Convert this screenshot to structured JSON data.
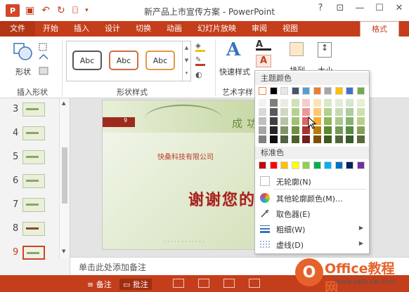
{
  "window": {
    "title": "新产品上市宣传方案 - PowerPoint",
    "app_icon_letter": "P",
    "controls": [
      "?",
      "⊡",
      "—",
      "☐",
      "✕"
    ]
  },
  "tabs": [
    "文件",
    "开始",
    "插入",
    "设计",
    "切换",
    "动画",
    "幻灯片放映",
    "审阅",
    "视图",
    "格式"
  ],
  "ribbon": {
    "shape_label": "形状",
    "insert_shapes_group": "插入形状",
    "shape_styles_group": "形状样式",
    "art_text_group": "艺术字样",
    "quick_styles_label": "快速样式",
    "arrange_label": "排列",
    "size_label": "大小",
    "abc_samples": [
      "Abc",
      "Abc",
      "Abc"
    ],
    "abc_border_colors": [
      "#555555",
      "#d16b44",
      "#e29a45"
    ]
  },
  "slides": {
    "numbers": [
      "3",
      "4",
      "5",
      "6",
      "7",
      "8",
      "9"
    ],
    "selected": "9"
  },
  "slide_content": {
    "company": "快桑科技有限公司",
    "big_text": "谢谢您的",
    "header_text": "成功",
    "tag_number": "9"
  },
  "notes": {
    "placeholder": "单击此处添加备注"
  },
  "statusbar": {
    "notes_label": "备注",
    "comments_label": "批注"
  },
  "dropdown": {
    "theme_colors_label": "主题颜色",
    "standard_colors_label": "标准色",
    "theme_top_row": [
      "#ffffff",
      "#000000",
      "#e7e6e6",
      "#44546a",
      "#5b9bd5",
      "#ed7d31",
      "#a5a5a5",
      "#ffc000",
      "#4472c4",
      "#70ad47"
    ],
    "theme_columns": [
      [
        "#f2f2f2",
        "#d9d9d9",
        "#bfbfbf",
        "#a6a6a6",
        "#808080"
      ],
      [
        "#7f7f7f",
        "#595959",
        "#404040",
        "#262626",
        "#0d0d0d"
      ],
      [
        "#e8ece3",
        "#cfd8c2",
        "#b5c4a1",
        "#7f956a",
        "#52643f"
      ],
      [
        "#cfe1b5",
        "#b7d193",
        "#9fc270",
        "#6f9141",
        "#4a612b"
      ],
      [
        "#f4cccc",
        "#e99999",
        "#de6666",
        "#a83333",
        "#701f1f"
      ],
      [
        "#fde3b8",
        "#fbc772",
        "#f9ab2c",
        "#b97a0b",
        "#7b5107"
      ],
      [
        "#d9e7c6",
        "#b3cf8e",
        "#8db756",
        "#5b8a2c",
        "#3c5c1d"
      ],
      [
        "#e3ecd8",
        "#c7d9b2",
        "#abc78b",
        "#77995a",
        "#4f663c"
      ],
      [
        "#d6e6cf",
        "#aecd9f",
        "#86b46f",
        "#558a3f",
        "#385c2a"
      ],
      [
        "#e7efd7",
        "#cfdfb0",
        "#b7cf88",
        "#86a057",
        "#596b3a"
      ]
    ],
    "standard_colors": [
      "#c00000",
      "#ff0000",
      "#ffc000",
      "#ffff00",
      "#92d050",
      "#00b050",
      "#00b0f0",
      "#0070c0",
      "#002060",
      "#7030a0"
    ],
    "items": [
      {
        "label": "无轮廓(N)",
        "icon": "no-outline-icon",
        "submenu": false
      },
      {
        "label": "其他轮廓颜色(M)...",
        "icon": "color-wheel-icon",
        "submenu": false
      },
      {
        "label": "取色器(E)",
        "icon": "eyedropper-icon",
        "submenu": false
      },
      {
        "label": "粗细(W)",
        "icon": "line-weight-icon",
        "submenu": true
      },
      {
        "label": "虚线(D)",
        "icon": "dash-icon",
        "submenu": true
      }
    ]
  },
  "watermark": {
    "brand": "Office教程网",
    "url": "www.pptxxw.com"
  }
}
